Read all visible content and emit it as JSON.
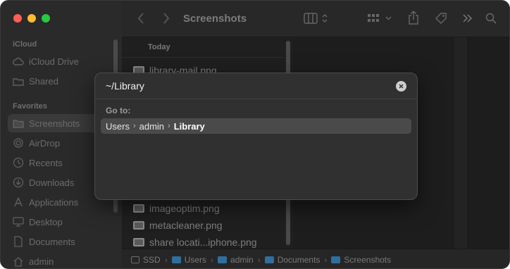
{
  "window": {
    "title": "Screenshots"
  },
  "sidebar": {
    "sections": [
      {
        "title": "iCloud",
        "items": [
          {
            "label": "iCloud Drive",
            "icon": "cloud-icon"
          },
          {
            "label": "Shared",
            "icon": "shared-folder-icon"
          }
        ]
      },
      {
        "title": "Favorites",
        "items": [
          {
            "label": "Screenshots",
            "icon": "folder-icon",
            "selected": true
          },
          {
            "label": "AirDrop",
            "icon": "airdrop-icon"
          },
          {
            "label": "Recents",
            "icon": "clock-icon"
          },
          {
            "label": "Downloads",
            "icon": "download-icon"
          },
          {
            "label": "Applications",
            "icon": "applications-icon"
          },
          {
            "label": "Desktop",
            "icon": "desktop-icon"
          },
          {
            "label": "Documents",
            "icon": "document-icon"
          },
          {
            "label": "admin",
            "icon": "home-icon"
          }
        ]
      }
    ]
  },
  "list": {
    "group_header": "Today",
    "files": [
      "library-mail.png",
      "imageoptim.png",
      "metacleaner.png",
      "share locati...iphone.png"
    ]
  },
  "pathbar": {
    "items": [
      "SSD",
      "Users",
      "admin",
      "Documents",
      "Screenshots"
    ]
  },
  "dialog": {
    "input_value": "~/Library",
    "goto_label": "Go to:",
    "result": [
      "Users",
      "admin",
      "Library"
    ]
  },
  "colors": {
    "accent_folder": "#2e6f9e",
    "traffic_red": "#fe5f57",
    "traffic_yellow": "#febc2e",
    "traffic_green": "#28c840"
  }
}
